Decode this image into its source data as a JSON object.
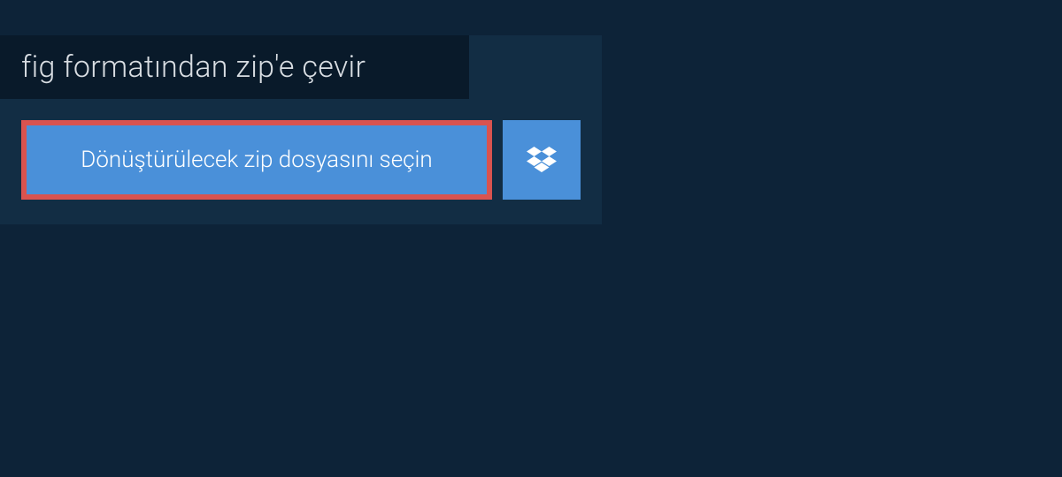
{
  "title": "fig formatından zip'e çevir",
  "select_button_label": "Dönüştürülecek zip dosyasını seçin",
  "colors": {
    "background": "#0d2338",
    "panel": "#122d44",
    "title_bar": "#091a2a",
    "button": "#4a90d9",
    "highlight_border": "#d9534f",
    "text_light": "#ffffff",
    "text_muted": "#d8dde2"
  }
}
